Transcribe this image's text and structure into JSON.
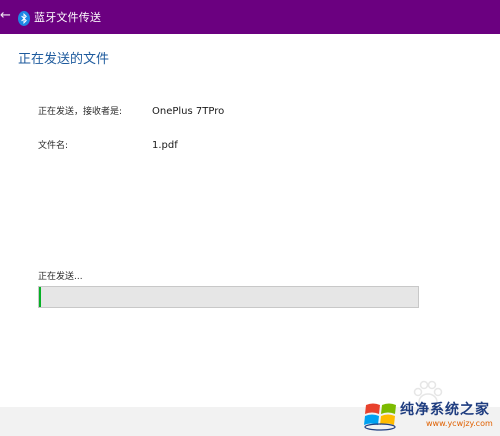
{
  "titlebar": {
    "back_icon": "arrow-left-icon",
    "app_icon": "bluetooth-icon",
    "title": "蓝牙文件传送",
    "bg_color": "#6b0080"
  },
  "main": {
    "heading": "正在发送的文件",
    "heading_color": "#1d5a9d",
    "recipient_label": "正在发送，接收者是:",
    "recipient_value": "OnePlus 7TPro",
    "filename_label": "文件名:",
    "filename_value": "1.pdf",
    "status_label": "正在发送...",
    "progress_percent": 0.5,
    "progress_color": "#06b025"
  },
  "watermark": {
    "logo_icon": "windows-logo-icon",
    "name": "纯净系统之家",
    "url": "www.ycwjzy.com"
  }
}
